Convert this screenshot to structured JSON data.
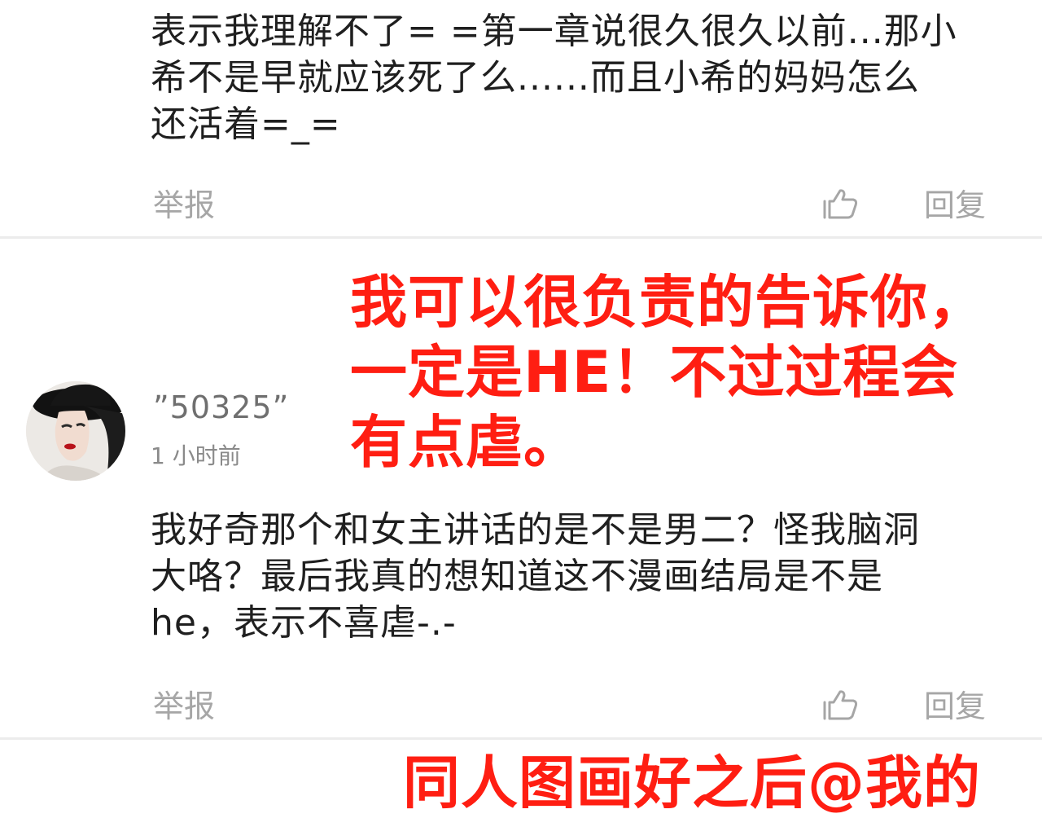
{
  "comments": [
    {
      "text_lines": [
        "表示我理解不了= =第一章说很久很久以前...那小",
        "希不是早就应该死了么......而且小希的妈妈怎么",
        "还活着=_="
      ],
      "report_label": "举报",
      "reply_label": "回复"
    },
    {
      "username": "”50325”",
      "timestamp": "1 小时前",
      "text_lines": [
        "我好奇那个和女主讲话的是不是男二？怪我脑洞",
        "大咯？最后我真的想知道这不漫画结局是不是",
        "he，表示不喜虐-.-"
      ],
      "report_label": "举报",
      "reply_label": "回复"
    }
  ],
  "annotations": {
    "reply_lines": [
      "我可以很负责的告诉你，",
      "一定是HE！不过过程会",
      "有点虐。"
    ],
    "bottom_line": "同人图画好之后@我的"
  },
  "icons": {
    "like": "thumbs-up-icon",
    "avatar": "user-avatar"
  },
  "colors": {
    "annotation_red": "#ff1e12",
    "action_gray": "#a6a6a6",
    "text_dark": "#1f1f1f"
  }
}
